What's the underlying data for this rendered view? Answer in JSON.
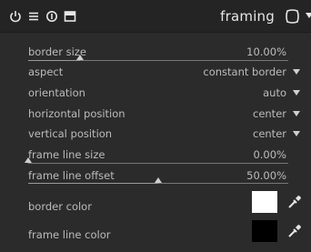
{
  "header": {
    "title": "framing",
    "icons": [
      "power-icon",
      "multi-instance-icon",
      "reset-icon",
      "presets-icon",
      "presets-menu-icon",
      "more-icon"
    ]
  },
  "params": {
    "border_size": {
      "label": "border size",
      "value": "10.00%",
      "fraction": 0.2
    },
    "aspect": {
      "label": "aspect",
      "value": "constant border"
    },
    "orientation": {
      "label": "orientation",
      "value": "auto"
    },
    "horizontal_position": {
      "label": "horizontal position",
      "value": "center"
    },
    "vertical_position": {
      "label": "vertical position",
      "value": "center"
    },
    "frame_line_size": {
      "label": "frame line size",
      "value": "0.00%",
      "fraction": 0.0
    },
    "frame_line_offset": {
      "label": "frame line offset",
      "value": "50.00%",
      "fraction": 0.5
    },
    "border_color": {
      "label": "border color",
      "color": "#ffffff"
    },
    "frame_line_color": {
      "label": "frame line color",
      "color": "#000000"
    }
  },
  "colors": {
    "background": "#2b2b2b",
    "header": "#242424",
    "text": "#bcbcbc"
  }
}
